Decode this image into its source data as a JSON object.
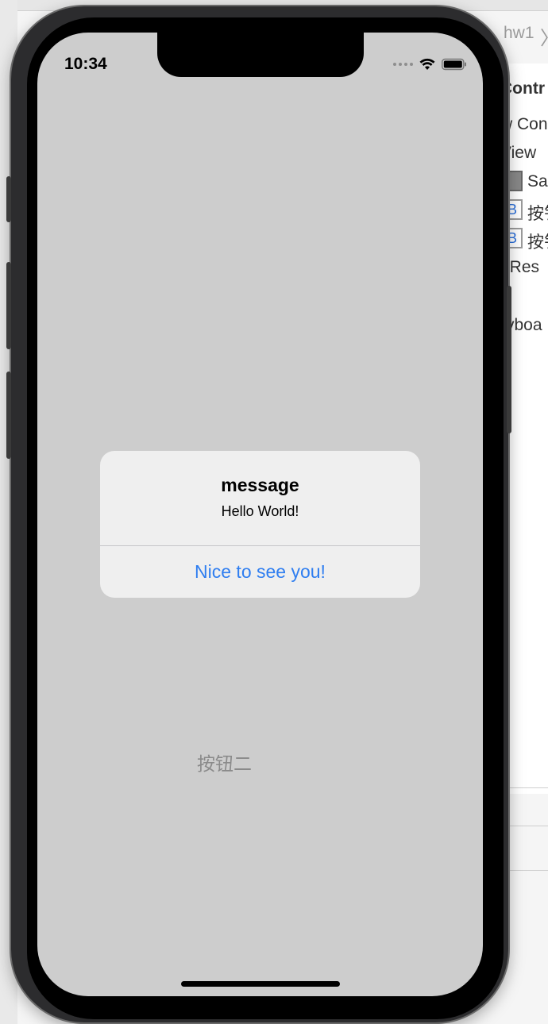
{
  "xcode": {
    "tab_title": "hw1",
    "outline": {
      "item1": "Contr",
      "item2": "w Con",
      "item3": "View",
      "item4": "Sa",
      "item5": "按钅",
      "item6": "按钅",
      "item7": "t Res",
      "item8": "ryboa"
    }
  },
  "status_bar": {
    "time": "10:34"
  },
  "alert": {
    "title": "message",
    "message": "Hello World!",
    "action_label": "Nice to see you!"
  },
  "screen": {
    "button_two_label": "按钮二"
  },
  "colors": {
    "screen_background": "#cdcdcd",
    "alert_background": "#efefef",
    "alert_action": "#2f7ef0",
    "button_two_text": "#8a8a8a"
  }
}
